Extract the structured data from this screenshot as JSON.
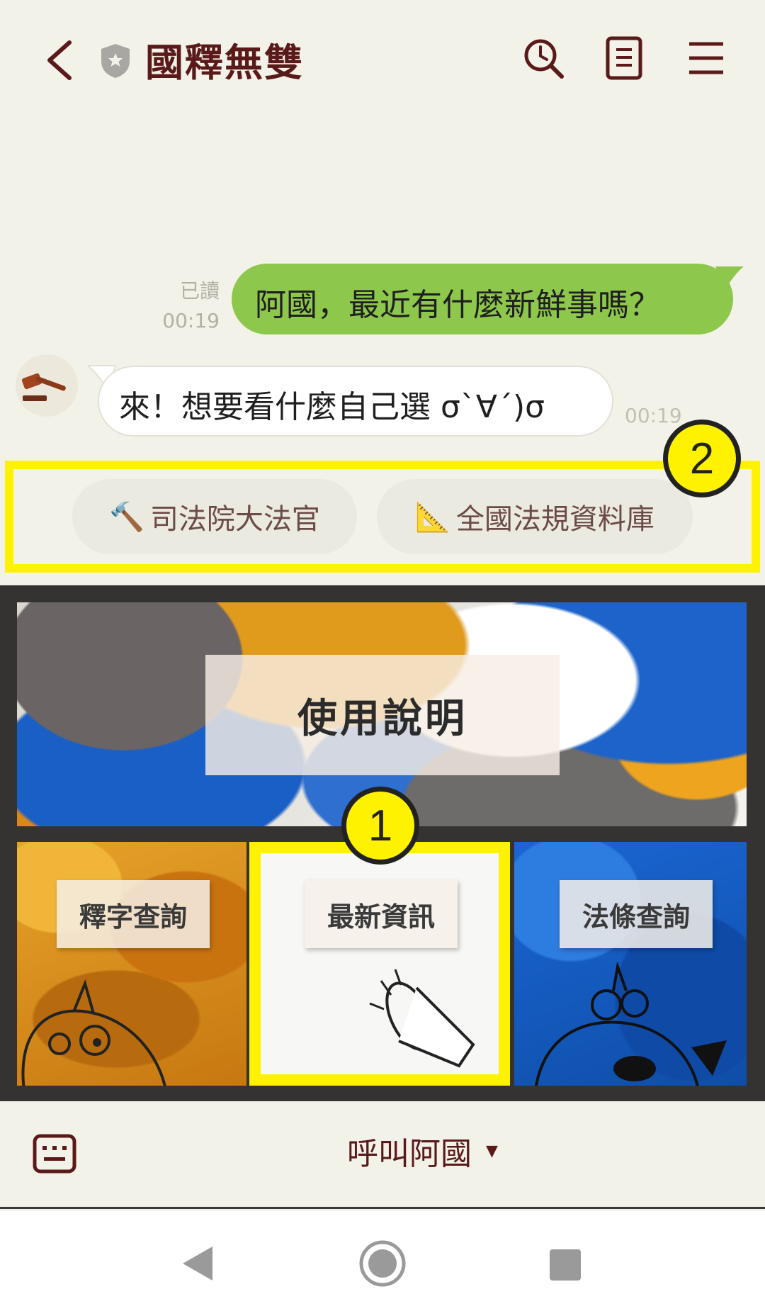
{
  "header": {
    "title": "國釋無雙"
  },
  "chat": {
    "outgoing": {
      "read_label": "已讀",
      "time": "00:19",
      "text": "阿國，最近有什麼新鮮事嗎？"
    },
    "incoming": {
      "text": "來！想要看什麼自己選 σ`∀´)σ",
      "time": "00:19"
    }
  },
  "quick_replies": [
    {
      "emoji": "🔨",
      "label": "司法院大法官"
    },
    {
      "emoji": "📐",
      "label": "全國法規資料庫"
    }
  ],
  "markers": {
    "one": "1",
    "two": "2"
  },
  "rich_menu": {
    "top_label": "使用說明",
    "left_label": "釋字查詢",
    "middle_label": "最新資訊",
    "right_label": "法條查詢"
  },
  "bottom_bar": {
    "call_label": "呼叫阿國",
    "call_arrow": "▼"
  },
  "colors": {
    "background": "#f3f2e9",
    "brand_text": "#5a1a1a",
    "outgoing_bubble": "#8dc74c",
    "highlight": "#fff200"
  }
}
